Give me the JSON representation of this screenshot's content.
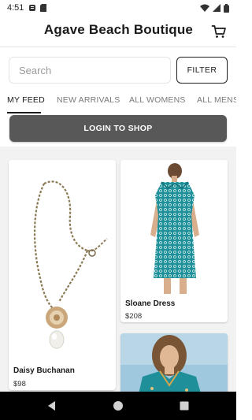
{
  "status_bar": {
    "time": "4:51",
    "icons": [
      "notification-icon",
      "sim-icon",
      "wifi-icon",
      "signal-icon",
      "battery-icon"
    ]
  },
  "header": {
    "title": "Agave Beach Boutique",
    "cart_icon": "cart-icon"
  },
  "search": {
    "placeholder": "Search",
    "value": ""
  },
  "filter_button": {
    "label": "FILTER"
  },
  "tabs": [
    {
      "label": "MY FEED",
      "active": true
    },
    {
      "label": "NEW ARRIVALS",
      "active": false
    },
    {
      "label": "ALL WOMENS",
      "active": false
    },
    {
      "label": "ALL MENS",
      "active": false
    }
  ],
  "login_button": {
    "label": "LOGIN TO SHOP"
  },
  "products": [
    {
      "name": "Daisy Buchanan",
      "price": "$98",
      "image": "pearl-pendant-necklace"
    },
    {
      "name": "Sloane Dress",
      "price": "$208",
      "image": "teal-print-shirt-dress"
    },
    {
      "name": "",
      "price": "",
      "image": "teal-embroidered-top"
    }
  ],
  "nav": {
    "back": "back-icon",
    "home": "home-icon",
    "recents": "recents-icon"
  },
  "colors": {
    "login_bg": "#585858",
    "feed_bg": "#f2f2f2",
    "dress_teal": "#1f8f9a",
    "nav_bg": "#000000"
  }
}
